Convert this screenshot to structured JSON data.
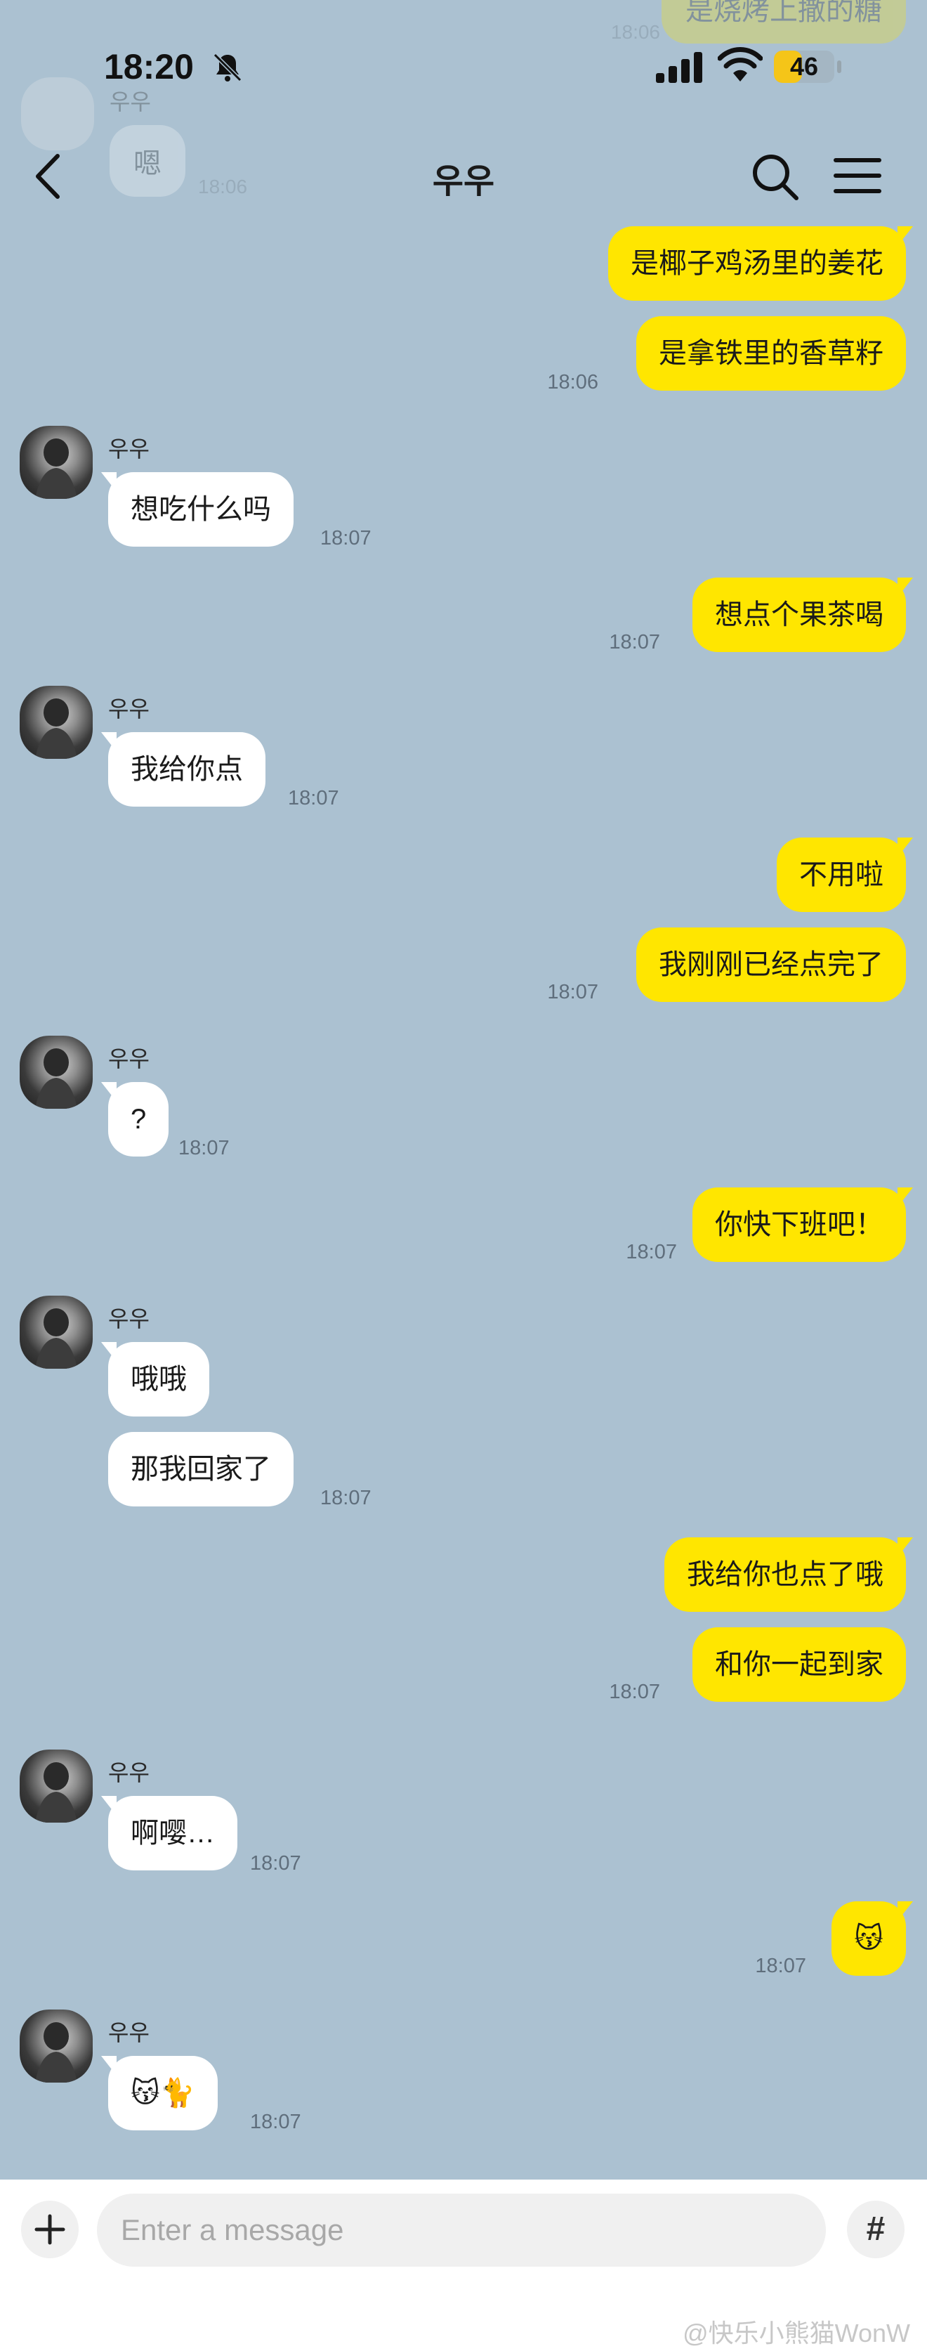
{
  "status_bar": {
    "time": "18:20",
    "battery": "46",
    "battery_level": 0.46
  },
  "header": {
    "title": "우우"
  },
  "ghost": {
    "bubble_right": "是烧烤上撒的糖",
    "time_right": "18:06",
    "name": "우우",
    "bubble_left": "嗯",
    "time_left": "18:06"
  },
  "messages": [
    {
      "id": "m1",
      "text": "是椰子鸡汤里的姜花"
    },
    {
      "id": "m2",
      "text": "是拿铁里的香草籽",
      "time": "18:06"
    },
    {
      "id": "m3",
      "sender": "우우",
      "text": "想吃什么吗",
      "time": "18:07"
    },
    {
      "id": "m4",
      "text": "想点个果茶喝",
      "time": "18:07"
    },
    {
      "id": "m5",
      "sender": "우우",
      "text": "我给你点",
      "time": "18:07"
    },
    {
      "id": "m6",
      "text": "不用啦"
    },
    {
      "id": "m7",
      "text": "我刚刚已经点完了",
      "time": "18:07"
    },
    {
      "id": "m8",
      "sender": "우우",
      "text": "?",
      "time": "18:07"
    },
    {
      "id": "m9",
      "text": "你快下班吧！",
      "time": "18:07"
    },
    {
      "id": "m10",
      "sender": "우우",
      "text": "哦哦"
    },
    {
      "id": "m11",
      "text": "那我回家了",
      "time": "18:07"
    },
    {
      "id": "m12",
      "text": "我给你也点了哦"
    },
    {
      "id": "m13",
      "text": "和你一起到家",
      "time": "18:07"
    },
    {
      "id": "m14",
      "sender": "우우",
      "text": "啊嘤…",
      "time": "18:07"
    },
    {
      "id": "m15",
      "text": "😽",
      "time": "18:07"
    },
    {
      "id": "m16",
      "sender": "우우",
      "text": "😽🐈",
      "time": "18:07"
    }
  ],
  "composer": {
    "placeholder": "Enter a message",
    "hash_label": "#"
  },
  "watermark": "@快乐小熊猫WonW"
}
